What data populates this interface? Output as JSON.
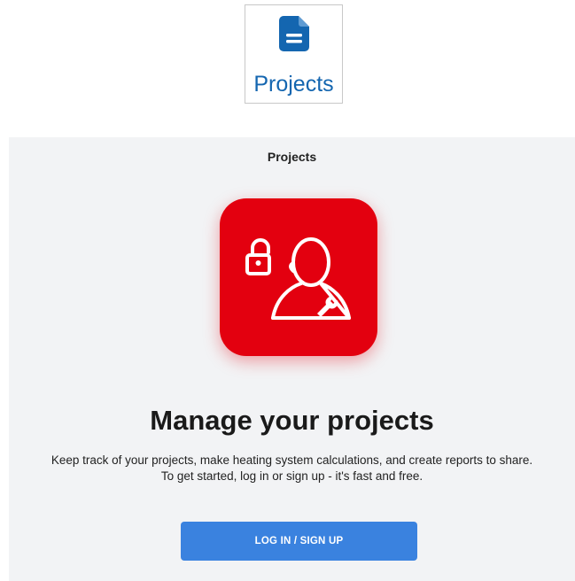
{
  "tab": {
    "label": "Projects",
    "icon": "document-icon",
    "color": "#1466b0"
  },
  "panel": {
    "title": "Projects"
  },
  "hero": {
    "icon": "user-lock-wrench-icon",
    "tile_color": "#e3000f"
  },
  "main": {
    "heading": "Manage your projects",
    "description_line1": "Keep track of your projects, make heating system calculations, and create reports to share.",
    "description_line2": "To get started, log in or sign up - it's fast and free."
  },
  "cta": {
    "label": "LOG IN / SIGN UP",
    "color": "#3a82df"
  }
}
